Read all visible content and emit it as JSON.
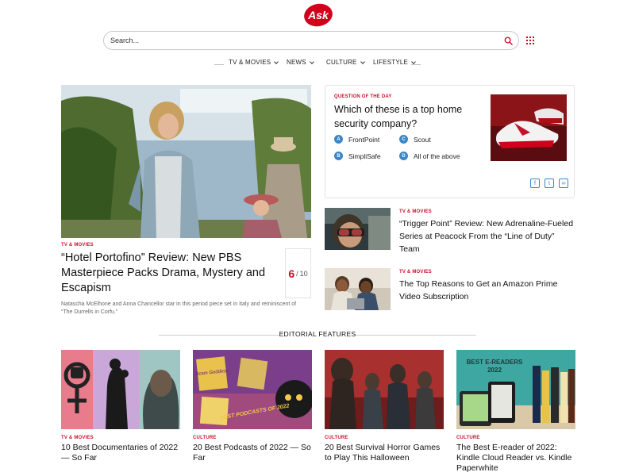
{
  "brand": {
    "logo_text": "Ask",
    "color": "#d0021b"
  },
  "search": {
    "placeholder": "Search...",
    "icon": "search-icon"
  },
  "nav": {
    "items": [
      {
        "label": "TV & MOVIES"
      },
      {
        "label": "NEWS"
      },
      {
        "label": "CULTURE"
      },
      {
        "label": "LIFESTYLE"
      }
    ]
  },
  "hero": {
    "tag": "TV & MOVIES",
    "title": "“Hotel Portofino” Review: New PBS Masterpiece Packs Drama, Mystery and Escapism",
    "description": "Natascha McElhone and Anna Chancellor star in this period piece set in Italy and reminiscent of “The Durrells in Corfu.”",
    "score": "6",
    "score_sep": "/",
    "score_max": "10"
  },
  "quiz": {
    "tag": "QUESTION OF THE DAY",
    "question": "Which of these is a top home security company?",
    "options": [
      {
        "letter": "A",
        "label": "FrontPoint"
      },
      {
        "letter": "C",
        "label": "Scout"
      },
      {
        "letter": "B",
        "label": "SimpliSafe"
      },
      {
        "letter": "D",
        "label": "All of the above"
      }
    ],
    "share": [
      {
        "glyph": "f",
        "icon": "facebook-icon"
      },
      {
        "glyph": "t",
        "icon": "twitter-icon"
      },
      {
        "glyph": "∞",
        "icon": "link-icon"
      }
    ]
  },
  "side_stories": [
    {
      "tag": "TV & MOVIES",
      "title": "“Trigger Point” Review: New Adrenaline-Fueled Series at Peacock From the “Line of Duty” Team"
    },
    {
      "tag": "TV & MOVIES",
      "title": "The Top Reasons to Get an Amazon Prime Video Subscription"
    }
  ],
  "editorial": {
    "heading": "EDITORIAL FEATURES",
    "cards": [
      {
        "tag": "TV & MOVIES",
        "title": "10 Best Documentaries of 2022 — So Far"
      },
      {
        "tag": "CULTURE",
        "title": "20 Best Podcasts of 2022 — So Far",
        "image_text_1": "Scam Goddess",
        "image_text_2": "BEST PODCASTS OF 2022"
      },
      {
        "tag": "CULTURE",
        "title": "20 Best Survival Horror Games to Play This Halloween"
      },
      {
        "tag": "CULTURE",
        "title": "The Best E-reader of 2022: Kindle Cloud Reader vs. Kindle Paperwhite",
        "image_text_1": "BEST E-READERS",
        "image_text_2": "2022"
      }
    ]
  }
}
